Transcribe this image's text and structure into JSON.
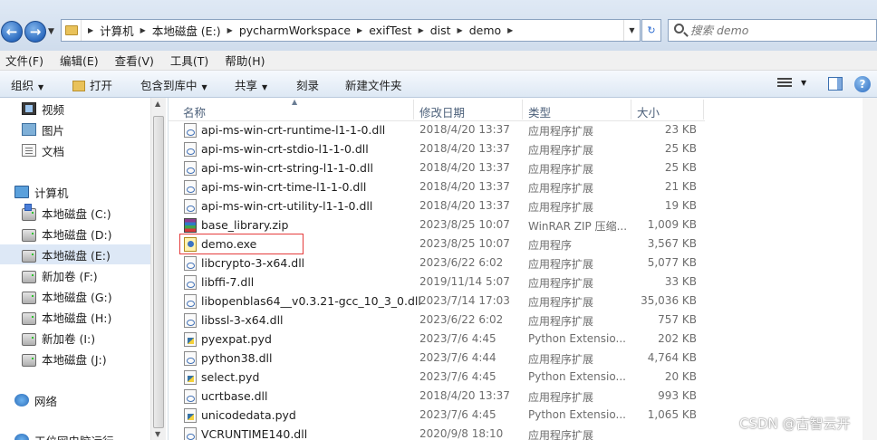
{
  "address_bar": {
    "path": [
      "计算机",
      "本地磁盘 (E:)",
      "pycharmWorkspace",
      "exifTest",
      "dist",
      "demo"
    ],
    "search_placeholder": "搜索 demo"
  },
  "menu": [
    "文件(F)",
    "编辑(E)",
    "查看(V)",
    "工具(T)",
    "帮助(H)"
  ],
  "toolbar": {
    "organize": "组织",
    "open": "打开",
    "include_in_library": "包含到库中",
    "share": "共享",
    "burn": "刻录",
    "new_folder": "新建文件夹"
  },
  "nav": {
    "libraries": [
      {
        "label": "视频",
        "icon": "video-icon"
      },
      {
        "label": "图片",
        "icon": "picture-icon"
      },
      {
        "label": "文档",
        "icon": "document-icon"
      }
    ],
    "computer": "计算机",
    "drives": [
      {
        "label": "本地磁盘 (C:)",
        "selected": false
      },
      {
        "label": "本地磁盘 (D:)",
        "selected": false
      },
      {
        "label": "本地磁盘 (E:)",
        "selected": true
      },
      {
        "label": "新加卷 (F:)",
        "selected": false
      },
      {
        "label": "本地磁盘 (G:)",
        "selected": false
      },
      {
        "label": "本地磁盘 (H:)",
        "selected": false
      },
      {
        "label": "新加卷 (I:)",
        "selected": false
      },
      {
        "label": "本地磁盘 (J:)",
        "selected": false
      }
    ],
    "network": "网络",
    "cut_off_item": "工位网电脑运行"
  },
  "columns": {
    "name": "名称",
    "modified": "修改日期",
    "type": "类型",
    "size": "大小"
  },
  "files": [
    {
      "name": "api-ms-win-crt-runtime-l1-1-0.dll",
      "date": "2018/4/20 13:37",
      "type": "应用程序扩展",
      "size": "23 KB",
      "icon": "dll"
    },
    {
      "name": "api-ms-win-crt-stdio-l1-1-0.dll",
      "date": "2018/4/20 13:37",
      "type": "应用程序扩展",
      "size": "25 KB",
      "icon": "dll"
    },
    {
      "name": "api-ms-win-crt-string-l1-1-0.dll",
      "date": "2018/4/20 13:37",
      "type": "应用程序扩展",
      "size": "25 KB",
      "icon": "dll"
    },
    {
      "name": "api-ms-win-crt-time-l1-1-0.dll",
      "date": "2018/4/20 13:37",
      "type": "应用程序扩展",
      "size": "21 KB",
      "icon": "dll"
    },
    {
      "name": "api-ms-win-crt-utility-l1-1-0.dll",
      "date": "2018/4/20 13:37",
      "type": "应用程序扩展",
      "size": "19 KB",
      "icon": "dll"
    },
    {
      "name": "base_library.zip",
      "date": "2023/8/25 10:07",
      "type": "WinRAR ZIP 压缩...",
      "size": "1,009 KB",
      "icon": "zip"
    },
    {
      "name": "demo.exe",
      "date": "2023/8/25 10:07",
      "type": "应用程序",
      "size": "3,567 KB",
      "icon": "exe"
    },
    {
      "name": "libcrypto-3-x64.dll",
      "date": "2023/6/22 6:02",
      "type": "应用程序扩展",
      "size": "5,077 KB",
      "icon": "dll"
    },
    {
      "name": "libffi-7.dll",
      "date": "2019/11/14 5:07",
      "type": "应用程序扩展",
      "size": "33 KB",
      "icon": "dll"
    },
    {
      "name": "libopenblas64__v0.3.21-gcc_10_3_0.dll",
      "date": "2023/7/14 17:03",
      "type": "应用程序扩展",
      "size": "35,036 KB",
      "icon": "dll"
    },
    {
      "name": "libssl-3-x64.dll",
      "date": "2023/6/22 6:02",
      "type": "应用程序扩展",
      "size": "757 KB",
      "icon": "dll"
    },
    {
      "name": "pyexpat.pyd",
      "date": "2023/7/6 4:45",
      "type": "Python Extensio...",
      "size": "202 KB",
      "icon": "pyd"
    },
    {
      "name": "python38.dll",
      "date": "2023/7/6 4:44",
      "type": "应用程序扩展",
      "size": "4,764 KB",
      "icon": "dll"
    },
    {
      "name": "select.pyd",
      "date": "2023/7/6 4:45",
      "type": "Python Extensio...",
      "size": "20 KB",
      "icon": "pyd"
    },
    {
      "name": "ucrtbase.dll",
      "date": "2018/4/20 13:37",
      "type": "应用程序扩展",
      "size": "993 KB",
      "icon": "dll"
    },
    {
      "name": "unicodedata.pyd",
      "date": "2023/7/6 4:45",
      "type": "Python Extensio...",
      "size": "1,065 KB",
      "icon": "pyd"
    },
    {
      "name": "VCRUNTIME140.dll",
      "date": "2020/9/8 18:10",
      "type": "应用程序扩展",
      "size": "",
      "icon": "dll"
    }
  ],
  "watermark": "CSDN @古智云开",
  "colors": {
    "highlight_box": "#e53c3c",
    "selected_nav": "#dde8f6"
  }
}
